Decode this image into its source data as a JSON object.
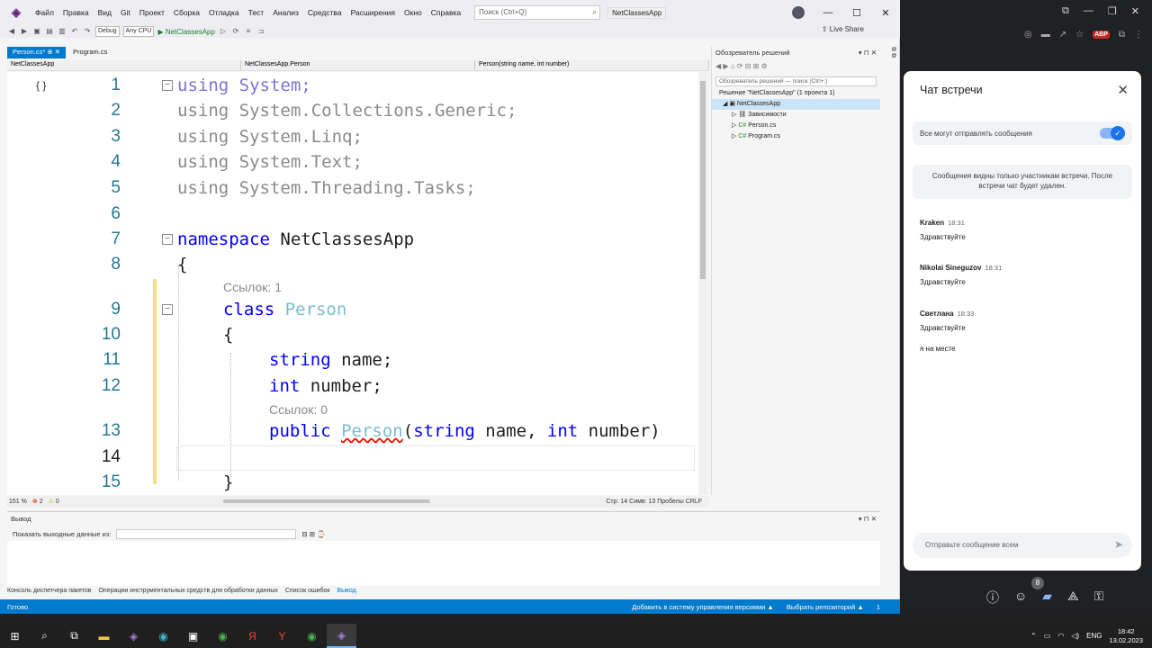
{
  "titlebar": {
    "menu": [
      "Файл",
      "Правка",
      "Вид",
      "Git",
      "Проект",
      "Сборка",
      "Отладка",
      "Тест",
      "Анализ",
      "Средства",
      "Расширения",
      "Окно",
      "Справка"
    ],
    "search_placeholder": "Поиск (Ctrl+Q)",
    "app_title": "NetClassesApp"
  },
  "toolbar": {
    "config": "Debug",
    "platform": "Any CPU",
    "run_label": "NetClassesApp",
    "liveshare": "Live Share"
  },
  "tabs": [
    {
      "label": "Person.cs*"
    },
    {
      "label": "Program.cs"
    }
  ],
  "navbar": {
    "project": "NetClassesApp",
    "class": "NetClassesApp.Person",
    "member": "Person(string name, int number)"
  },
  "code": {
    "l1": "using System;",
    "l2": "using System.Collections.Generic;",
    "l3": "using System.Linq;",
    "l4": "using System.Text;",
    "l5": "using System.Threading.Tasks;",
    "l7_kw": "namespace",
    "l7_name": " NetClassesApp",
    "l8": "{",
    "hint1": "Ссылок: 1",
    "l9_kw": "class",
    "l9_name": " Person",
    "l10": "{",
    "l11_kw": "string",
    "l11_rest": " name;",
    "l12_kw": "int",
    "l12_rest": " number;",
    "hint2": "Ссылок: 0",
    "l13_public": "public",
    "l13_name": "Person",
    "l13_open": "(",
    "l13_string": "string",
    "l13_p1": " name, ",
    "l13_int": "int",
    "l13_p2": " number)",
    "l15": "}",
    "line_numbers": [
      "1",
      "2",
      "3",
      "4",
      "5",
      "6",
      "7",
      "8",
      "9",
      "10",
      "11",
      "12",
      "13",
      "14",
      "15"
    ]
  },
  "editor_status": {
    "zoom": "151 %",
    "errors": "2",
    "warnings": "0",
    "position": "Стр: 14    Симв: 13    Пробелы    CRLF"
  },
  "solution_explorer": {
    "title": "Обозреватель решений",
    "search": "Обозреватель решений — поиск (Ctrl+;)",
    "items": [
      {
        "label": "Решение \"NetClassesApp\" (1 проекта 1)"
      },
      {
        "label": "NetClassesApp"
      },
      {
        "label": "Зависимости"
      },
      {
        "label": "Person.cs"
      },
      {
        "label": "Program.cs"
      }
    ]
  },
  "output": {
    "title": "Вывод",
    "show_label": "Показать выходные данные из:"
  },
  "bottom_tabs": [
    "Консоль диспетчера пакетов",
    "Операции инструментальных средств для обработки данных",
    "Список ошибок",
    "Вывод"
  ],
  "status": {
    "left": "Готово",
    "vcs": "Добавить в систему управления версиями ▲",
    "repo": "Выбрать репозиторий ▲",
    "notif": "1"
  },
  "chat": {
    "title": "Чат встречи",
    "toggle_label": "Все могут отправлять сообщения",
    "info": "Сообщения видны только участникам встречи. После встречи чат будет удален.",
    "messages": [
      {
        "name": "Kraken",
        "time": "18:31",
        "lines": [
          "Здравствуйте"
        ]
      },
      {
        "name": "Nikolai Sineguzov",
        "time": "18:31",
        "lines": [
          "Здравствуйте"
        ]
      },
      {
        "name": "Светлана",
        "time": "18:33",
        "lines": [
          "Здравствуйте",
          "я на месте"
        ]
      }
    ],
    "input_placeholder": "Отправьте сообщение всем",
    "participants_badge": "8"
  },
  "taskbar": {
    "lang": "ENG",
    "time": "18:42",
    "date": "13.02.2023"
  }
}
